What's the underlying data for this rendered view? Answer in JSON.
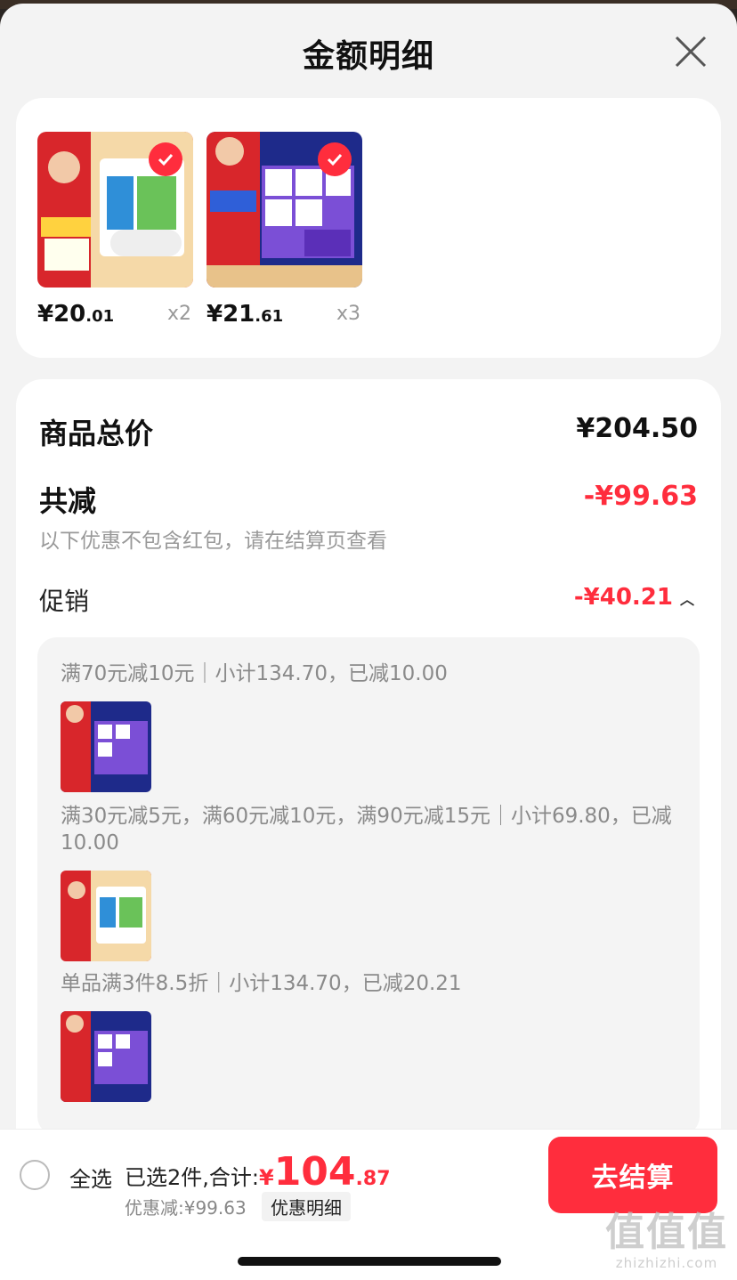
{
  "header": {
    "title": "金额明细"
  },
  "products": [
    {
      "price_main": "¥20",
      "price_cents": ".01",
      "qty": "x2"
    },
    {
      "price_main": "¥21",
      "price_cents": ".61",
      "qty": "x3"
    }
  ],
  "summary": {
    "total_label": "商品总价",
    "total_value": "¥204.50",
    "discount_label": "共减",
    "discount_value": "-¥99.63",
    "note": "以下优惠不包含红包，请在结算页查看",
    "promo_label": "促销",
    "promo_value": "-¥40.21"
  },
  "promos": [
    {
      "text": "满70元减10元｜小计134.70，已减10.00"
    },
    {
      "text": "满30元减5元，满60元减10元，满90元减15元｜小计69.80，已减10.00"
    },
    {
      "text": "单品满3件8.5折｜小计134.70，已减20.21"
    }
  ],
  "footer": {
    "select_all": "全选",
    "selected_text": "已选2件,合计:",
    "total_symbol": "¥",
    "total_main": "104",
    "total_cents": ".87",
    "saved_text": "优惠减:¥99.63",
    "detail_label": "优惠明细",
    "checkout_label": "去结算"
  },
  "watermark": {
    "main": "值值值",
    "sub": "zhizhizhi.com"
  },
  "colors": {
    "accent": "#ff2d3d",
    "background": "#f3f3f3",
    "card": "#ffffff"
  }
}
